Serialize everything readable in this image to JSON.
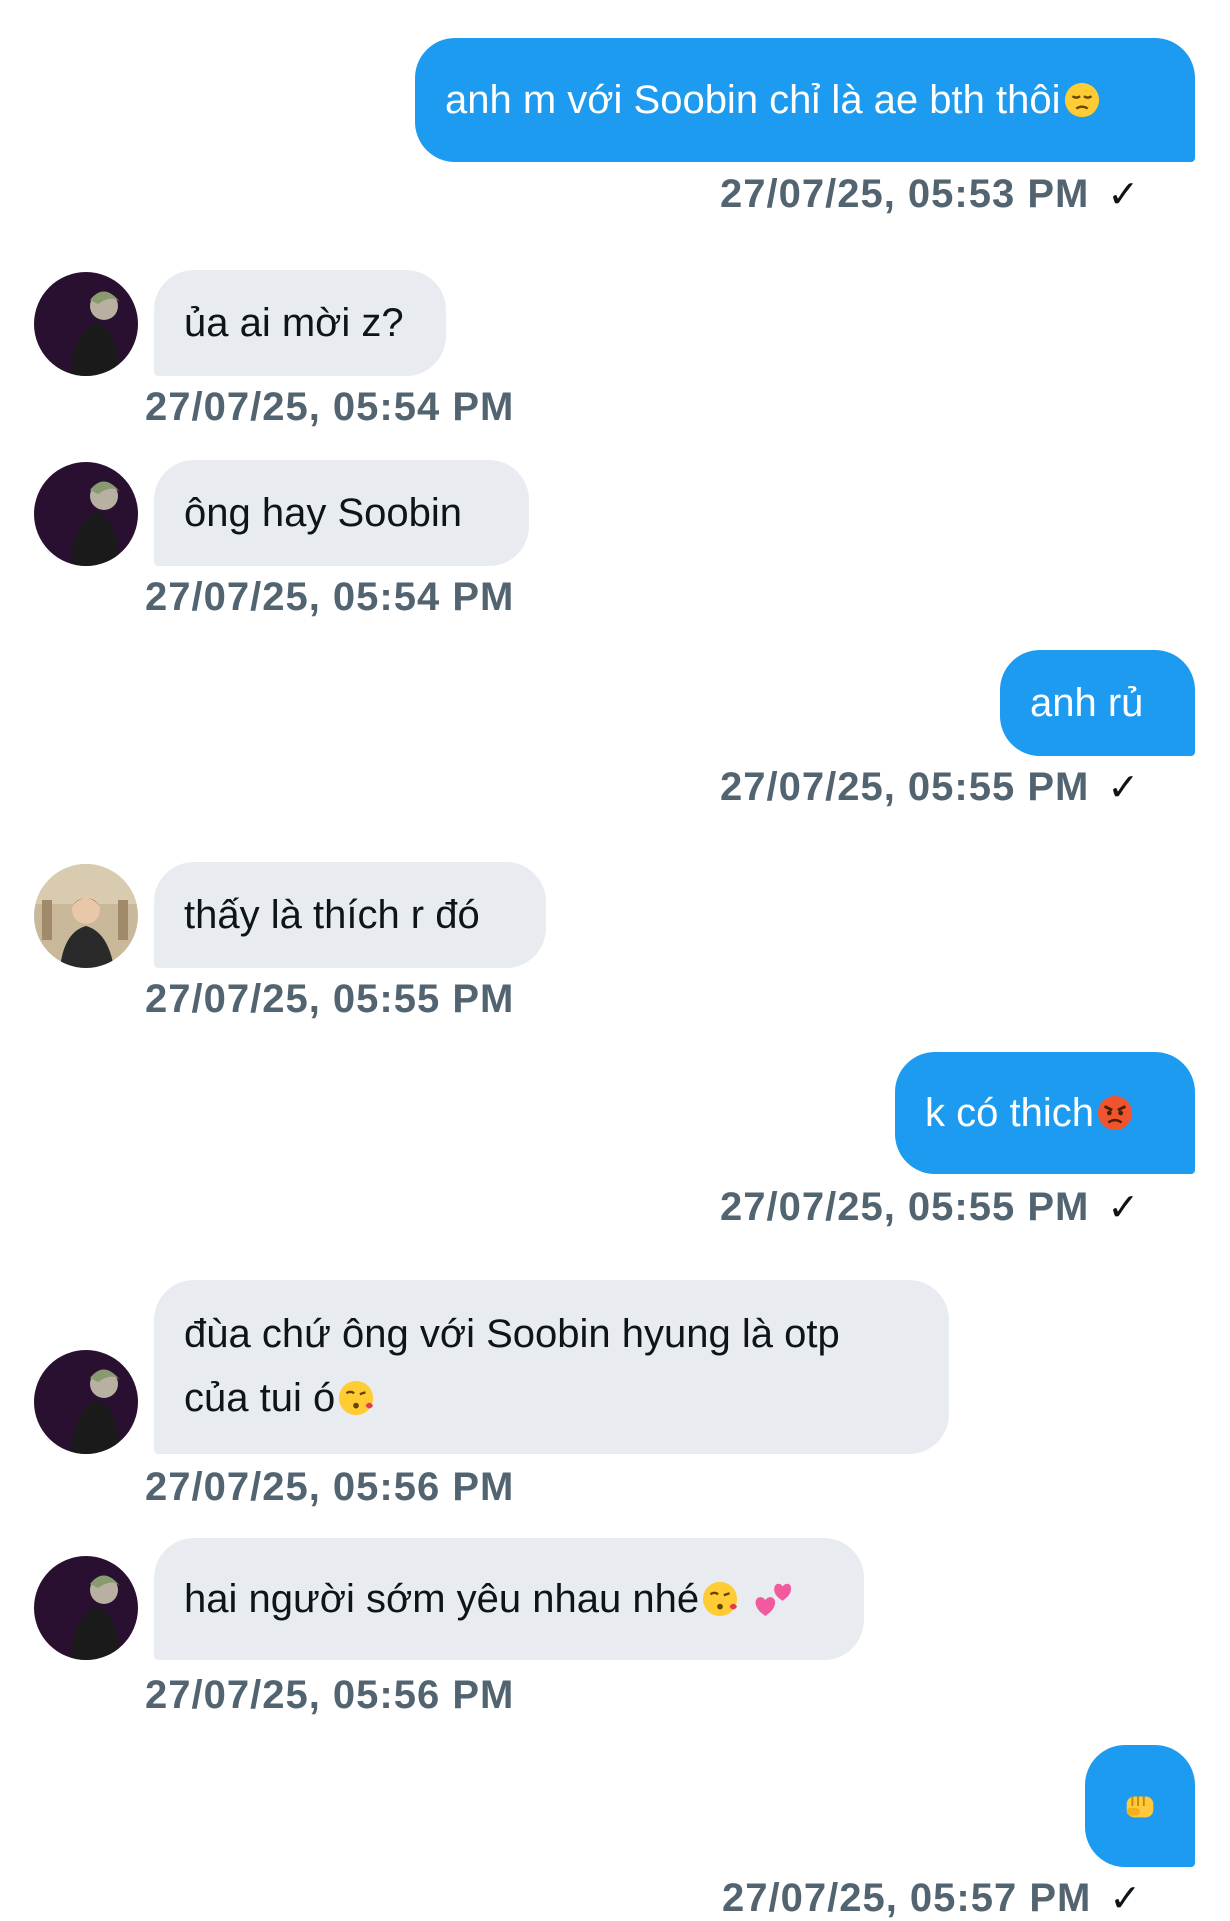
{
  "messages": [
    {
      "direction": "out",
      "text": "anh m với Soobin chỉ là ae bth thôi",
      "emoji": "pensive-face-emoji",
      "time": "27/07/25, 05:53 PM",
      "read_mark": "✓"
    },
    {
      "direction": "in",
      "text": "ủa ai mời z?",
      "time": "27/07/25, 05:54 PM"
    },
    {
      "direction": "in",
      "text": "ông hay Soobin",
      "time": "27/07/25, 05:54 PM"
    },
    {
      "direction": "out",
      "text": "anh rủ",
      "time": "27/07/25, 05:55 PM",
      "read_mark": "✓"
    },
    {
      "direction": "in",
      "text": "thấy là thích r đó",
      "time": "27/07/25, 05:55 PM"
    },
    {
      "direction": "out",
      "text": "k có thich",
      "emoji": "angry-face-emoji",
      "time": "27/07/25, 05:55 PM",
      "read_mark": "✓"
    },
    {
      "direction": "in",
      "text_line1": "đùa chứ ông với Soobin hyung là otp",
      "text_line2": "của tui ó",
      "emoji": "face-blowing-kiss-emoji",
      "time": "27/07/25, 05:56 PM"
    },
    {
      "direction": "in",
      "text": "hai người sớm yêu nhau nhé",
      "emoji": "face-blowing-kiss-emoji",
      "emoji2": "two-hearts-emoji",
      "time": "27/07/25, 05:56 PM"
    },
    {
      "direction": "out",
      "emoji": "oncoming-fist-emoji",
      "time": "27/07/25, 05:57 PM",
      "read_mark": "✓"
    }
  ],
  "colors": {
    "outgoing_bubble": "#1d9bf0",
    "incoming_bubble": "#e8ebef",
    "timestamp": "#536471",
    "text_dark": "#0f1419"
  }
}
